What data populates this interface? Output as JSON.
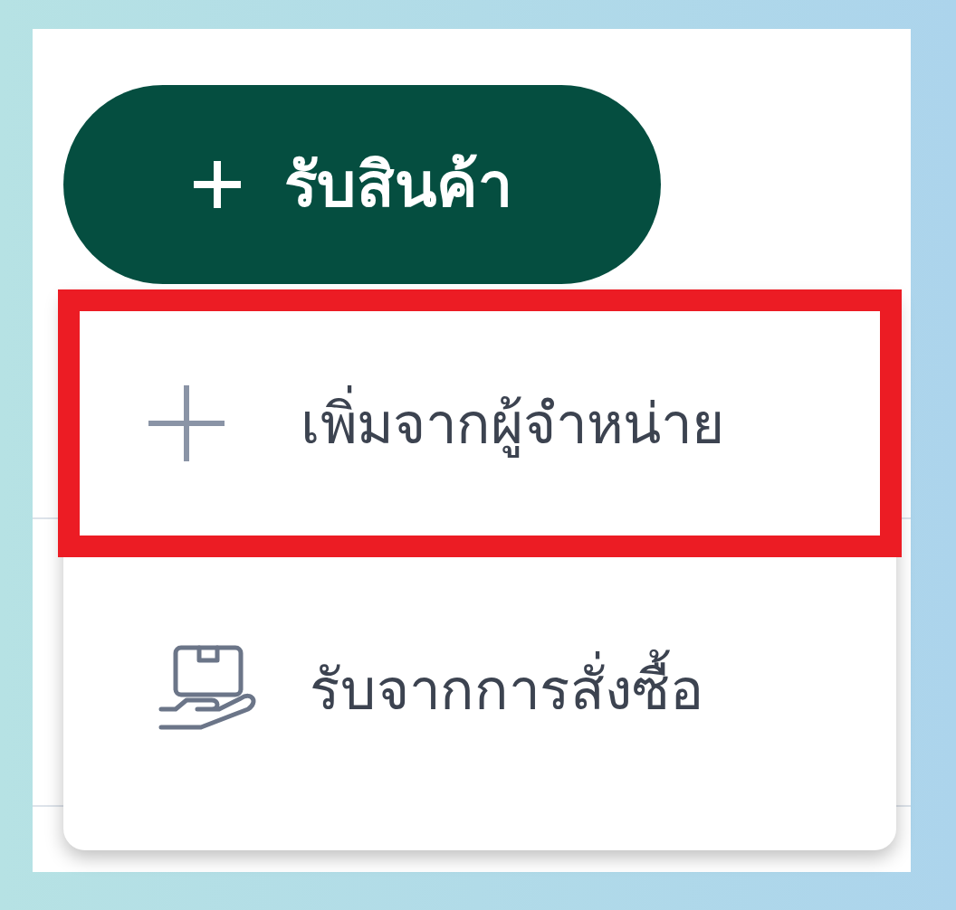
{
  "button": {
    "label": "รับสินค้า"
  },
  "menu": {
    "items": [
      {
        "kind": "plus",
        "label": "เพิ่มจากผู้จำหน่าย",
        "highlighted": true
      },
      {
        "kind": "hand-box",
        "label": "รับจากการสั่งซื้อ",
        "highlighted": false
      }
    ]
  }
}
